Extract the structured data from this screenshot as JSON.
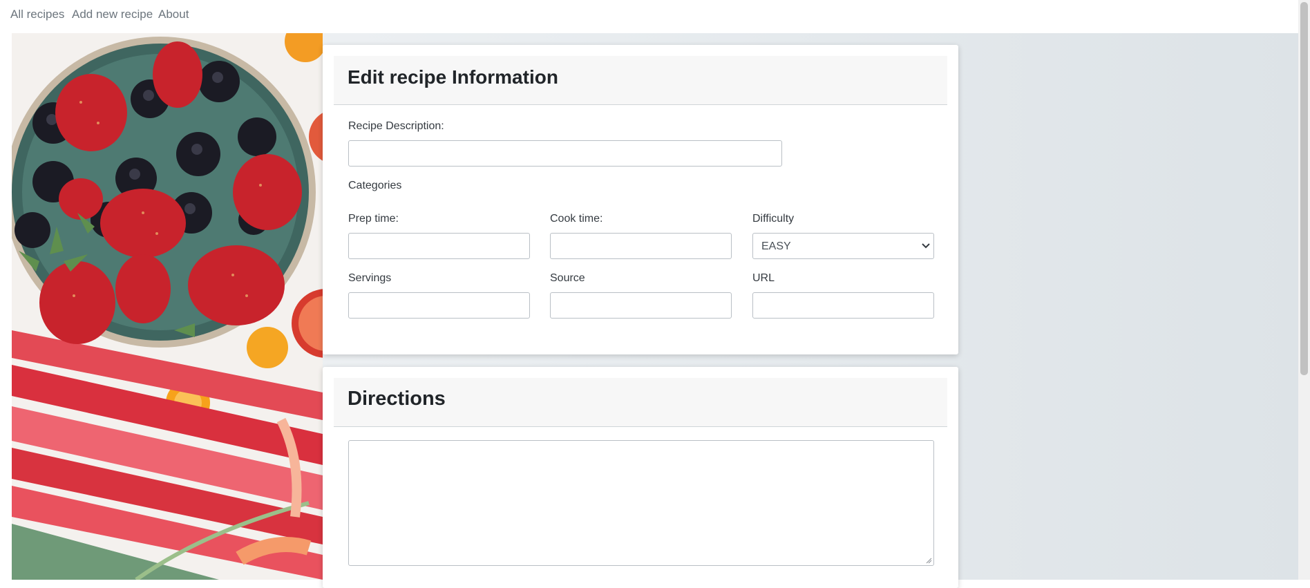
{
  "nav": {
    "all_recipes": "All recipes",
    "add_new_recipe": "Add new recipe",
    "about": "About"
  },
  "info_card": {
    "title": "Edit recipe Information",
    "description_label": "Recipe Description:",
    "description_value": "",
    "categories_label": "Categories",
    "prep_time_label": "Prep time:",
    "prep_time_value": "",
    "cook_time_label": "Cook time:",
    "cook_time_value": "",
    "difficulty_label": "Difficulty",
    "difficulty_value": "EASY",
    "servings_label": "Servings",
    "servings_value": "",
    "source_label": "Source",
    "source_value": "",
    "url_label": "URL",
    "url_value": ""
  },
  "directions_card": {
    "title": "Directions",
    "directions_value": ""
  },
  "colors": {
    "nav_link": "#6c757d",
    "card_header_bg": "#f7f7f7",
    "strawberry": "#c8232c",
    "blackberry": "#1b1b24",
    "rhubarb": "#e0404c"
  },
  "icons": {
    "difficulty_select": "chevron-down-icon",
    "textarea_resize": "resize-grip-icon"
  }
}
